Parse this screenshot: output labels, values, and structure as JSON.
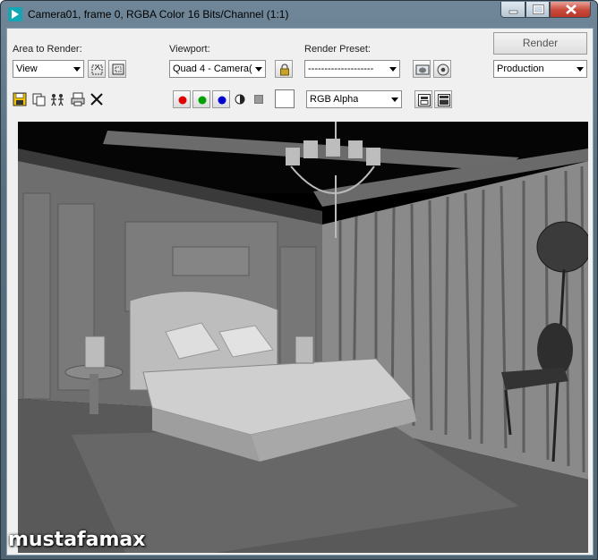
{
  "window": {
    "title": "Camera01, frame 0, RGBA Color 16 Bits/Channel (1:1)",
    "icon": "3dsmax-app-icon"
  },
  "area_to_render": {
    "label": "Area to Render:",
    "value": "View"
  },
  "viewport": {
    "label": "Viewport:",
    "value": "Quad 4 - Camera("
  },
  "render_preset": {
    "label": "Render Preset:",
    "value": "--------------------"
  },
  "render_button": {
    "label": "Render"
  },
  "production": {
    "value": "Production"
  },
  "channel": {
    "value": "RGB Alpha"
  },
  "colors": {
    "red_channel": "#e00000",
    "green_channel": "#00a000",
    "blue_channel": "#0000d0",
    "window_chrome": "#5f7686",
    "close_button": "#c9483a"
  },
  "watermark": "mustafamax"
}
